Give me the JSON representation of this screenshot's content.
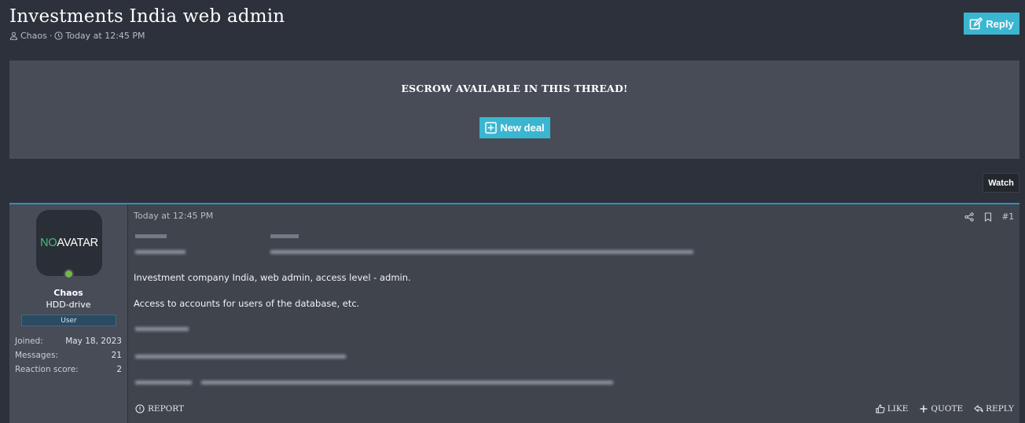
{
  "thread": {
    "title": "Investments India web admin",
    "author": "Chaos",
    "meta_separator": "·",
    "created": "Today at 12:45 PM",
    "reply_label": "Reply"
  },
  "escrow": {
    "title": "ESCROW AVAILABLE IN THIS THREAD!",
    "new_deal_label": "New deal"
  },
  "watch_label": "Watch",
  "post": {
    "date": "Today at 12:45 PM",
    "number": "#1",
    "user": {
      "avatar_no": "NO",
      "avatar_text": "AVATAR",
      "name": "Chaos",
      "title": "HDD-drive",
      "banner": "User",
      "stats": [
        {
          "label": "Joined:",
          "value": "May 18, 2023"
        },
        {
          "label": "Messages:",
          "value": "21"
        },
        {
          "label": "Reaction score:",
          "value": "2"
        }
      ]
    },
    "body": {
      "line1": "Investment company India, web admin, access level - admin.",
      "line2": "Access to accounts for users of the database, etc."
    },
    "actions": {
      "report": "REPORT",
      "like": "LIKE",
      "quote": "QUOTE",
      "reply": "REPLY"
    }
  },
  "colors": {
    "accent": "#3bb6d0",
    "background": "#2c313b",
    "panel": "#474c57",
    "online": "#74b846",
    "post_border": "#2f8fc0"
  }
}
